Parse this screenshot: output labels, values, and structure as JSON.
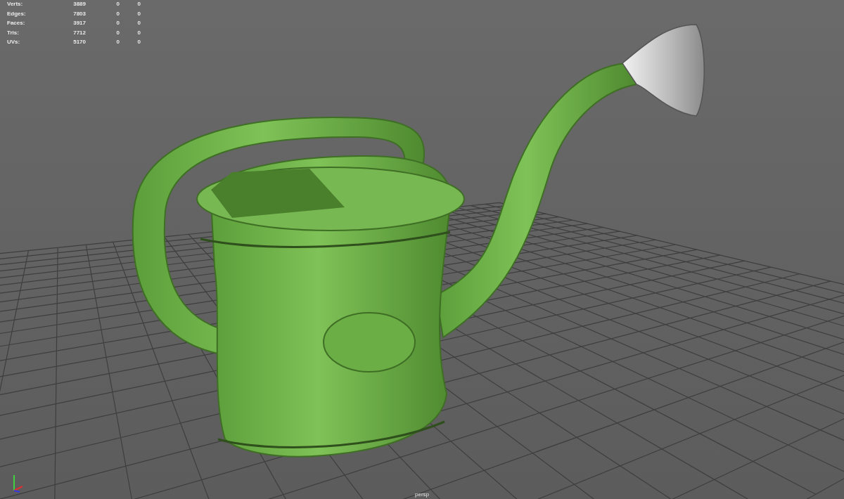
{
  "hud": {
    "rows": [
      {
        "label": "Verts:",
        "values": [
          "3889",
          "0",
          "0"
        ]
      },
      {
        "label": "Edges:",
        "values": [
          "7803",
          "0",
          "0"
        ]
      },
      {
        "label": "Faces:",
        "values": [
          "3917",
          "0",
          "0"
        ]
      },
      {
        "label": "Tris:",
        "values": [
          "7712",
          "0",
          "0"
        ]
      },
      {
        "label": "UVs:",
        "values": [
          "5170",
          "0",
          "0"
        ]
      }
    ]
  },
  "viewport": {
    "camera": "persp"
  }
}
